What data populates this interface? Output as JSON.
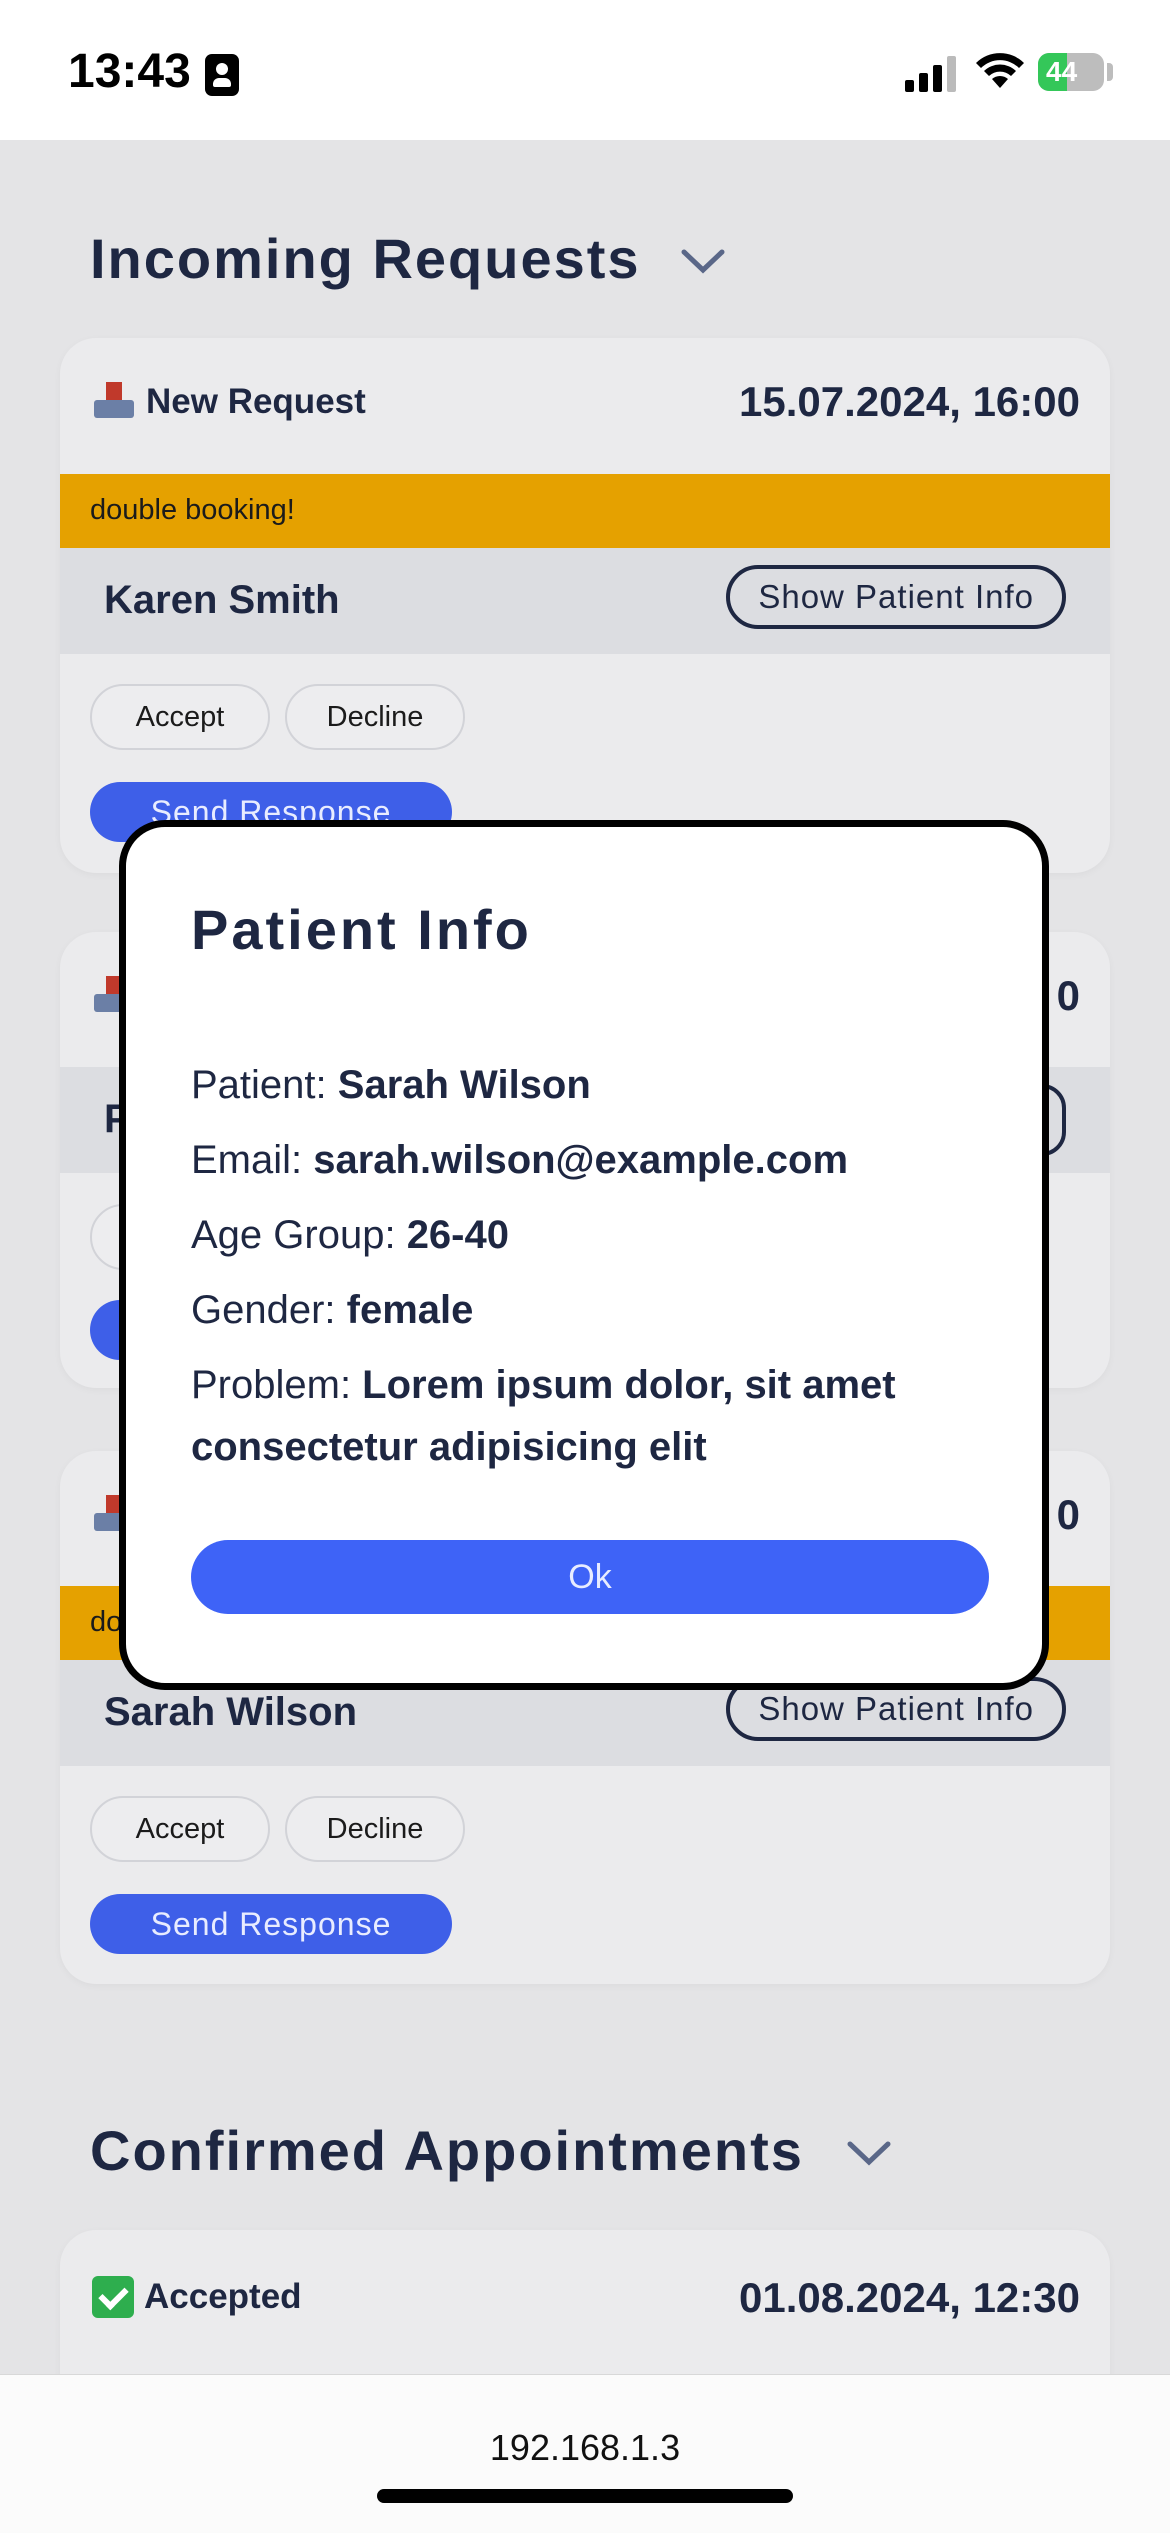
{
  "status_bar": {
    "time": "13:43",
    "battery": "44"
  },
  "sections": {
    "incoming_title": "Incoming Requests",
    "confirmed_title": "Confirmed Appointments"
  },
  "incoming_requests": [
    {
      "status": "New Request",
      "date": "15.07.2024, 16:00",
      "warning": "double booking!",
      "patient": "Karen Smith",
      "show_info_label": "Show Patient Info",
      "accept_label": "Accept",
      "decline_label": "Decline",
      "send_label": "Send Response"
    },
    {
      "date_visible_fragment": "0"
    },
    {
      "date_visible_fragment": "0",
      "warning_visible_fragment": "do",
      "patient": "Sarah Wilson",
      "show_info_label": "Show Patient Info",
      "accept_label": "Accept",
      "decline_label": "Decline",
      "send_label": "Send Response"
    }
  ],
  "confirmed": [
    {
      "status": "Accepted",
      "date": "01.08.2024, 12:30"
    }
  ],
  "modal": {
    "title": "Patient Info",
    "patient_label": "Patient: ",
    "patient_value": "Sarah Wilson",
    "email_label": "Email: ",
    "email_value": "sarah.wilson@example.com",
    "age_label": "Age Group: ",
    "age_value": "26-40",
    "gender_label": "Gender: ",
    "gender_value": "female",
    "problem_label": "Problem: ",
    "problem_value": "Lorem ipsum dolor, sit amet consectetur adipisicing elit",
    "ok_label": "Ok"
  },
  "browser": {
    "url": "192.168.1.3"
  },
  "colors": {
    "primary": "#3e63f7",
    "warning": "#e5a100",
    "text": "#1e2742",
    "accepted": "#2eae4e"
  },
  "icons": [
    "inbox-tray-icon",
    "check-mark-icon",
    "chevron-down-icon",
    "signal-icon",
    "wifi-icon",
    "battery-icon"
  ]
}
